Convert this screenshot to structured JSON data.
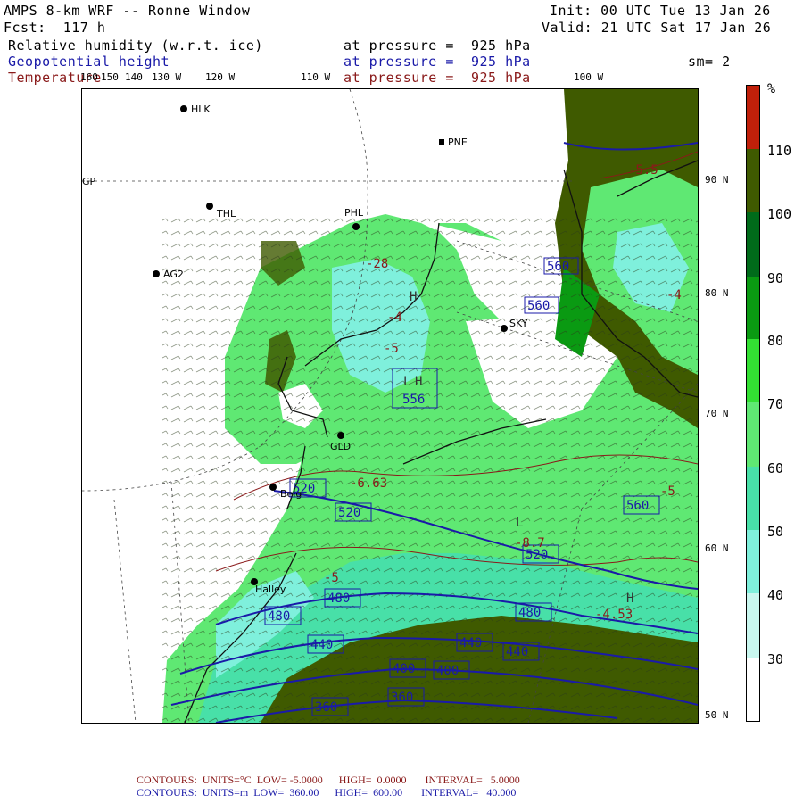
{
  "header": {
    "title": "AMPS 8-km WRF -- Ronne Window",
    "forecast": "Fcst:  117 h",
    "init": "Init: 00 UTC Tue 13 Jan 26",
    "valid": "Valid: 21 UTC Sat 17 Jan 26",
    "rh_label": "Relative humidity (w.r.t. ice)",
    "rh_level": "at pressure =  925 hPa",
    "geo_label": "Geopotential height",
    "geo_level": "at pressure =  925 hPa",
    "smooth": "sm= 2",
    "temp_label": "Temperature",
    "temp_level": "at pressure =  925 hPa"
  },
  "lon_labels": [
    "160",
    "150",
    "140",
    "130 W",
    "120 W",
    "110 W",
    "100 W",
    "GP"
  ],
  "lat_labels": [
    "90 N",
    "80 N",
    "70 N",
    "60 N",
    "50 N"
  ],
  "stations": [
    "HLK",
    "PNE",
    "THL",
    "PHL",
    "AG2",
    "SKY",
    "GLD",
    "Belg",
    "Halley"
  ],
  "height_contour_labels": [
    "560",
    "560",
    "556",
    "520",
    "520",
    "520",
    "560",
    "480",
    "480",
    "480",
    "440",
    "440",
    "440",
    "400",
    "400",
    "360",
    "360"
  ],
  "temp_contour_labels": [
    "-28",
    "-4",
    "-5",
    "-6.63",
    "-5",
    "-8.7",
    "-4.53",
    "-5",
    "-4",
    "-5.5"
  ],
  "pressure_markers": [
    "H",
    "L",
    "H",
    "L",
    "H"
  ],
  "colorbar": {
    "unit": "%",
    "labels": [
      "110",
      "100",
      "90",
      "80",
      "70",
      "60",
      "50",
      "40",
      "30"
    ],
    "colors": [
      "#c0200a",
      "#3f5a00",
      "#006b1a",
      "#0a9a12",
      "#33e033",
      "#5fe873",
      "#48e0a8",
      "#7ff0dc",
      "#c9f7ef",
      "#ffffff"
    ]
  },
  "footer": {
    "temp_line": "CONTOURS:  UNITS=°C  LOW= -5.0000      HIGH=  0.0000       INTERVAL=   5.0000",
    "height_line": "CONTOURS:  UNITS=m  LOW=  360.00      HIGH=  600.00       INTERVAL=   40.000"
  }
}
